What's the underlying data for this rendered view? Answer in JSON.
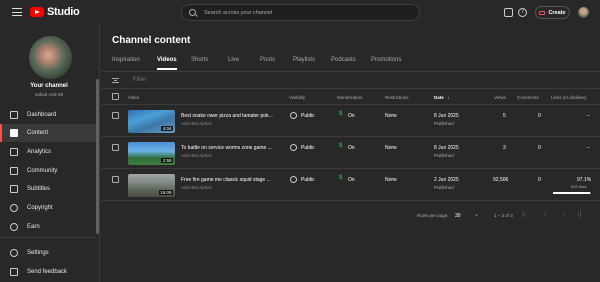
{
  "app": {
    "logo_text": "Studio"
  },
  "search": {
    "placeholder": "Search across your channel"
  },
  "header": {
    "create_label": "Create"
  },
  "channel": {
    "name": "Your channel",
    "handle": "sahad cmk 69"
  },
  "sidebar": {
    "items": [
      {
        "label": "Dashboard",
        "icon": "dashboard-icon"
      },
      {
        "label": "Content",
        "icon": "content-icon",
        "active": true
      },
      {
        "label": "Analytics",
        "icon": "analytics-icon"
      },
      {
        "label": "Community",
        "icon": "community-icon"
      },
      {
        "label": "Subtitles",
        "icon": "subtitles-icon"
      },
      {
        "label": "Copyright",
        "icon": "copyright-icon"
      },
      {
        "label": "Earn",
        "icon": "earn-icon"
      }
    ],
    "bottom_items": [
      {
        "label": "Settings",
        "icon": "gear-icon"
      },
      {
        "label": "Send feedback",
        "icon": "feedback-icon"
      }
    ]
  },
  "main": {
    "title": "Channel content",
    "tabs": [
      "Inspiration",
      "Videos",
      "Shorts",
      "Live",
      "Posts",
      "Playlists",
      "Podcasts",
      "Promotions"
    ],
    "active_tab": "Videos",
    "filter_placeholder": "Filter",
    "columns": {
      "video": "Video",
      "visibility": "Visibility",
      "monetization": "Monetization",
      "restrictions": "Restrictions",
      "date": "Date",
      "date_sort": "↓",
      "views": "Views",
      "comments": "Comments",
      "likes": "Likes (vs dislikes)"
    },
    "rows": [
      {
        "title": "Best snake ower pizza and tamater pok...",
        "description": "Add description",
        "duration": "4:04",
        "visibility": "Public",
        "monetization": "On",
        "restrictions": "None",
        "date": "8 Jun 2025",
        "status": "Published",
        "views": "5",
        "comments": "0",
        "likes": "–",
        "likes_count": "",
        "like_ratio": null
      },
      {
        "title": "To battle on service worms zone game ...",
        "description": "Add description",
        "duration": "2:59",
        "visibility": "Public",
        "monetization": "On",
        "restrictions": "None",
        "date": "8 Jun 2025",
        "status": "Published",
        "views": "3",
        "comments": "0",
        "likes": "–",
        "likes_count": "",
        "like_ratio": null
      },
      {
        "title": "Free fire game me classic squid stage ...",
        "description": "Add description",
        "duration": "16:09",
        "visibility": "Public",
        "monetization": "On",
        "restrictions": "None",
        "date": "2 Jun 2025",
        "status": "Published",
        "views": "92,506",
        "comments": "0",
        "likes": "97.1%",
        "likes_count": "839 likes",
        "like_ratio": 0.971
      }
    ],
    "pagination": {
      "rows_label": "Rows per page:",
      "rows_value": "30",
      "range": "1 – 3 of 3"
    }
  }
}
